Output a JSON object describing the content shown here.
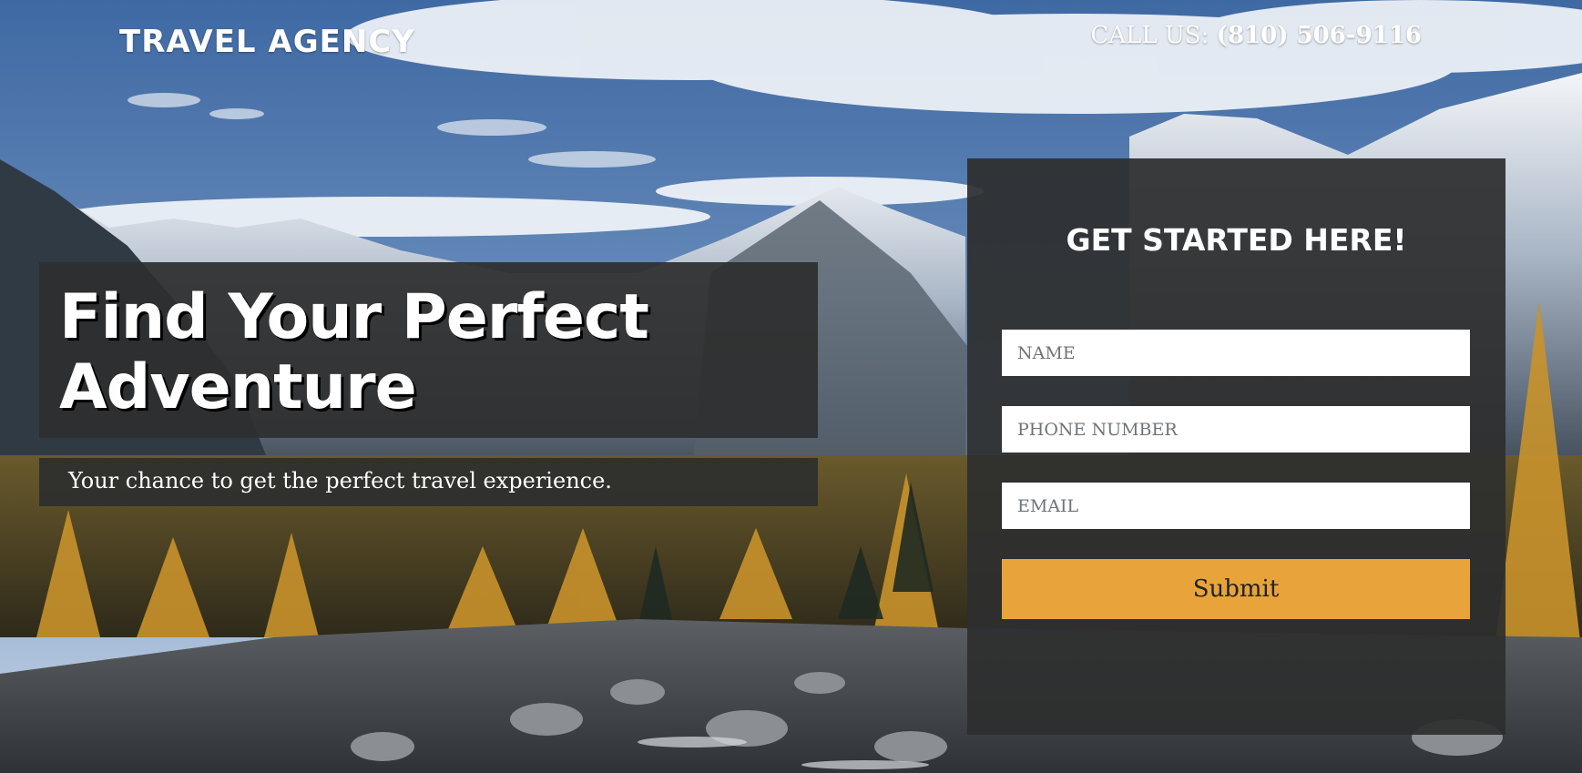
{
  "header": {
    "brand": "TRAVEL AGENCY",
    "call_label": "CALL US:",
    "phone": "(810) 506-9116"
  },
  "hero": {
    "title": "Find Your Perfect\nAdventure",
    "subtitle": "Your chance to get the perfect travel experience."
  },
  "form": {
    "title": "GET STARTED HERE!",
    "name_placeholder": "NAME",
    "phone_placeholder": "PHONE NUMBER",
    "email_placeholder": "EMAIL",
    "submit_label": "Submit"
  },
  "colors": {
    "panel": "#2d2e2e",
    "accent": "#e8a33b",
    "text": "#ffffff"
  }
}
